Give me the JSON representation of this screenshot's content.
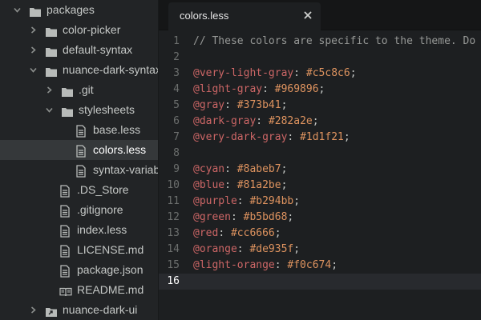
{
  "tree": {
    "items": [
      {
        "label": "packages",
        "kind": "folder",
        "expanded": true,
        "depth": 0
      },
      {
        "label": "color-picker",
        "kind": "folder",
        "expanded": false,
        "depth": 1
      },
      {
        "label": "default-syntax",
        "kind": "folder",
        "expanded": false,
        "depth": 1
      },
      {
        "label": "nuance-dark-syntax",
        "kind": "folder",
        "expanded": true,
        "depth": 1
      },
      {
        "label": ".git",
        "kind": "folder",
        "expanded": false,
        "depth": 2
      },
      {
        "label": "stylesheets",
        "kind": "folder",
        "expanded": true,
        "depth": 2
      },
      {
        "label": "base.less",
        "kind": "file",
        "depth": 3
      },
      {
        "label": "colors.less",
        "kind": "file",
        "depth": 3,
        "selected": true
      },
      {
        "label": "syntax-variables.less",
        "kind": "file",
        "depth": 3
      },
      {
        "label": ".DS_Store",
        "kind": "file",
        "depth": 2
      },
      {
        "label": ".gitignore",
        "kind": "file",
        "depth": 2
      },
      {
        "label": "index.less",
        "kind": "file",
        "depth": 2
      },
      {
        "label": "LICENSE.md",
        "kind": "file",
        "depth": 2
      },
      {
        "label": "package.json",
        "kind": "file",
        "depth": 2
      },
      {
        "label": "README.md",
        "kind": "book",
        "depth": 2
      },
      {
        "label": "nuance-dark-ui",
        "kind": "folder-link",
        "expanded": false,
        "depth": 1
      }
    ]
  },
  "tab": {
    "title": "colors.less",
    "close_icon": "close-icon"
  },
  "editor": {
    "cursor_line": 16,
    "lines": [
      {
        "num": "1",
        "comment": "// These colors are specific to the theme. Do"
      },
      {
        "num": "2"
      },
      {
        "num": "3",
        "var": "@very-light-gray",
        "value": "#c5c8c6"
      },
      {
        "num": "4",
        "var": "@light-gray",
        "value": "#969896"
      },
      {
        "num": "5",
        "var": "@gray",
        "value": "#373b41"
      },
      {
        "num": "6",
        "var": "@dark-gray",
        "value": "#282a2e"
      },
      {
        "num": "7",
        "var": "@very-dark-gray",
        "value": "#1d1f21"
      },
      {
        "num": "8"
      },
      {
        "num": "9",
        "var": "@cyan",
        "value": "#8abeb7"
      },
      {
        "num": "10",
        "var": "@blue",
        "value": "#81a2be"
      },
      {
        "num": "11",
        "var": "@purple",
        "value": "#b294bb"
      },
      {
        "num": "12",
        "var": "@green",
        "value": "#b5bd68"
      },
      {
        "num": "13",
        "var": "@red",
        "value": "#cc6666"
      },
      {
        "num": "14",
        "var": "@orange",
        "value": "#de935f"
      },
      {
        "num": "15",
        "var": "@light-orange",
        "value": "#f0c674"
      },
      {
        "num": "16"
      }
    ]
  },
  "colors": {
    "tree_bg": "#222426",
    "editor_bg": "#1d1f21",
    "selected_row": "#35383a",
    "variable": "#cc6666",
    "hex_value": "#de935f",
    "comment": "#969896"
  }
}
